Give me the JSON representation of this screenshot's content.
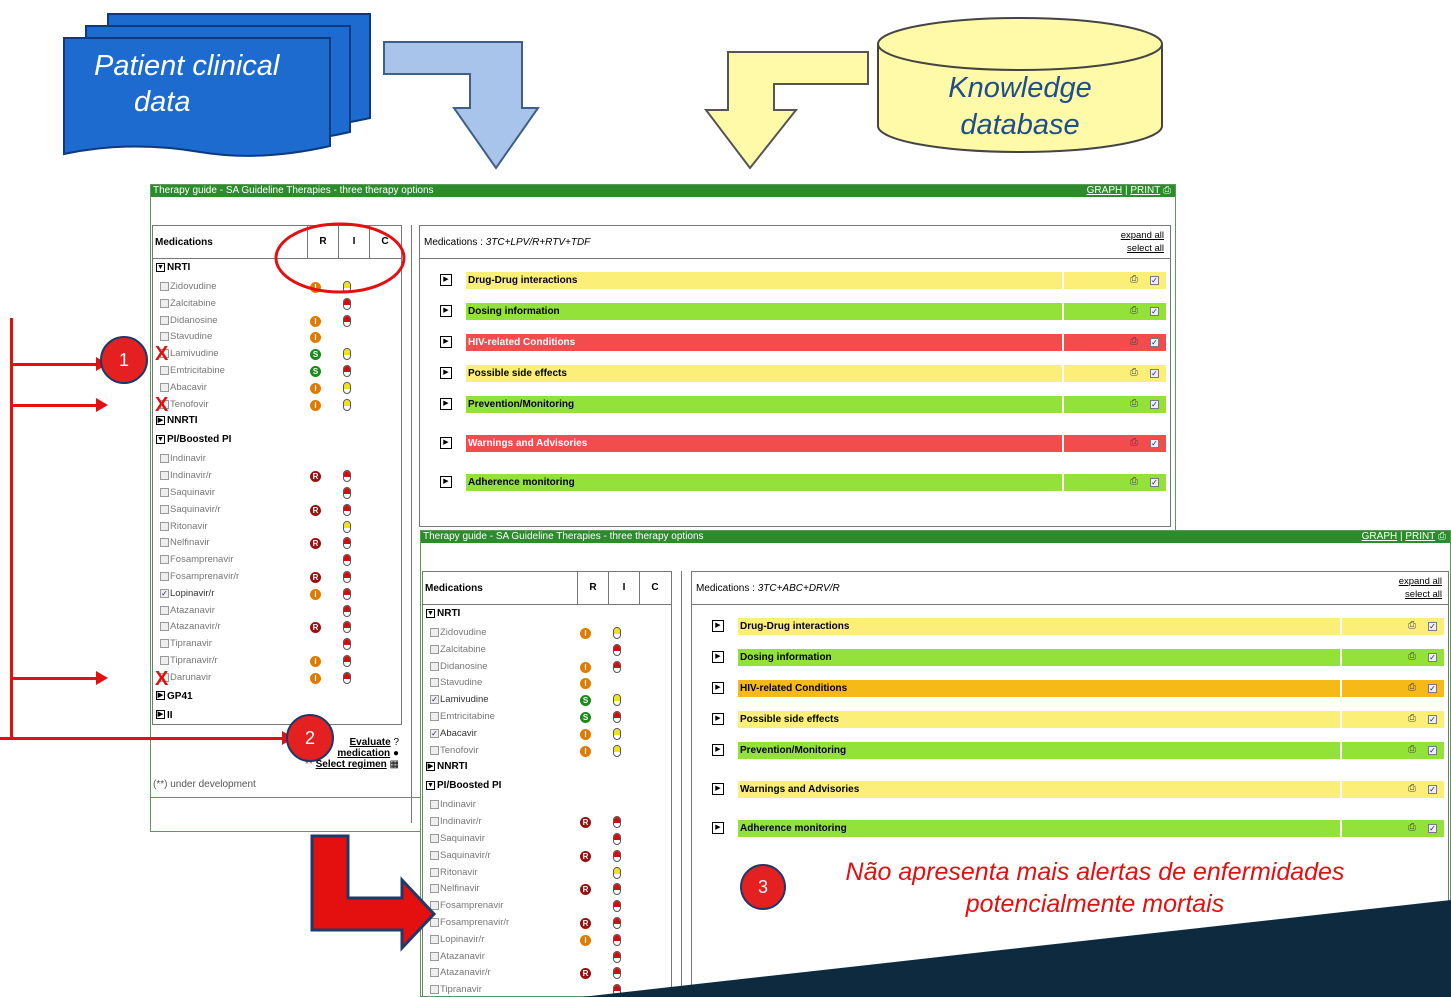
{
  "diagram": {
    "source_label_lines": [
      "Patient clinical",
      "data"
    ],
    "db_label_lines": [
      "Knowledge",
      "database"
    ],
    "badges": [
      "1",
      "2",
      "3"
    ],
    "caption_lines": [
      "Não apresenta mais alertas de enfermidades",
      "potencialmente mortais"
    ],
    "colors": {
      "source": "#1e6bd0",
      "db": "#fffaa8",
      "arrow_blue": "#a9c4ea",
      "arrow_yellow": "#fffaa8",
      "marker_red": "#e41010"
    }
  },
  "window1": {
    "title": "Therapy guide - SA Guideline Therapies - three therapy options",
    "graph_link": "GRAPH",
    "sep": "|",
    "print_link": "PRINT",
    "medications_header": "Medications",
    "col_r": "R",
    "col_i": "I",
    "col_c": "C",
    "selected_label": "Medications :",
    "selected_regimen": "3TC+LPV/R+RTV+TDF",
    "expand_all": "expand all",
    "select_all": "select all",
    "groups": {
      "nrti": "NRTI",
      "nnrti": "NNRTI",
      "pi": "PI/Boosted PI",
      "gp41": "GP41",
      "ii": "II"
    },
    "nrti_meds": [
      "Zidovudine",
      "Zalcitabine",
      "Didanosine",
      "Stavudine",
      "Lamivudine",
      "Emtricitabine",
      "Abacavir",
      "Tenofovir"
    ],
    "pi_meds": [
      "Indinavir",
      "Indinavir/r",
      "Saquinavir",
      "Saquinavir/r",
      "Ritonavir",
      "Nelfinavir",
      "Fosamprenavir",
      "Fosamprenavir/r",
      "Lopinavir/r",
      "Atazanavir",
      "Atazanavir/r",
      "Tipranavir",
      "Tipranavir/r",
      "Darunavir"
    ],
    "sections": [
      {
        "label": "Drug-Drug interactions",
        "color": "#fbef78"
      },
      {
        "label": "Dosing information",
        "color": "#93e23a"
      },
      {
        "label": "HIV-related Conditions",
        "color": "#f24c4c"
      },
      {
        "label": "Possible side effects",
        "color": "#fbef78"
      },
      {
        "label": "Prevention/Monitoring",
        "color": "#93e23a"
      },
      {
        "label": "Warnings and Advisories",
        "color": "#f24c4c"
      },
      {
        "label": "Adherence monitoring",
        "color": "#93e23a"
      }
    ],
    "evaluate": "Evaluate",
    "medication_part": "medication",
    "medication_prefix": "P",
    "select_regimen": "Select regimen",
    "stars": "**",
    "under_dev": "(**) under development"
  },
  "window2": {
    "title": "Therapy guide - SA Guideline Therapies - three therapy options",
    "graph_link": "GRAPH",
    "sep": "|",
    "print_link": "PRINT",
    "medications_header": "Medications",
    "col_r": "R",
    "col_i": "I",
    "col_c": "C",
    "selected_label": "Medications :",
    "selected_regimen": "3TC+ABC+DRV/R",
    "expand_all": "expand all",
    "select_all": "select all",
    "groups": {
      "nrti": "NRTI",
      "nnrti": "NNRTI",
      "pi": "PI/Boosted PI"
    },
    "nrti_meds": [
      "Zidovudine",
      "Zalcitabine",
      "Didanosine",
      "Stavudine",
      "Lamivudine",
      "Emtricitabine",
      "Abacavir",
      "Tenofovir"
    ],
    "pi_meds": [
      "Indinavir",
      "Indinavir/r",
      "Saquinavir",
      "Saquinavir/r",
      "Ritonavir",
      "Nelfinavir",
      "Fosamprenavir",
      "Fosamprenavir/r",
      "Lopinavir/r",
      "Atazanavir",
      "Atazanavir/r",
      "Tipranavir"
    ],
    "sections": [
      {
        "label": "Drug-Drug interactions",
        "color": "#fbef78"
      },
      {
        "label": "Dosing information",
        "color": "#93e23a"
      },
      {
        "label": "HIV-related Conditions",
        "color": "#f6ba18"
      },
      {
        "label": "Possible side effects",
        "color": "#fbef78"
      },
      {
        "label": "Prevention/Monitoring",
        "color": "#93e23a"
      },
      {
        "label": "Warnings and Advisories",
        "color": "#fbef78"
      },
      {
        "label": "Adherence monitoring",
        "color": "#93e23a"
      }
    ]
  }
}
